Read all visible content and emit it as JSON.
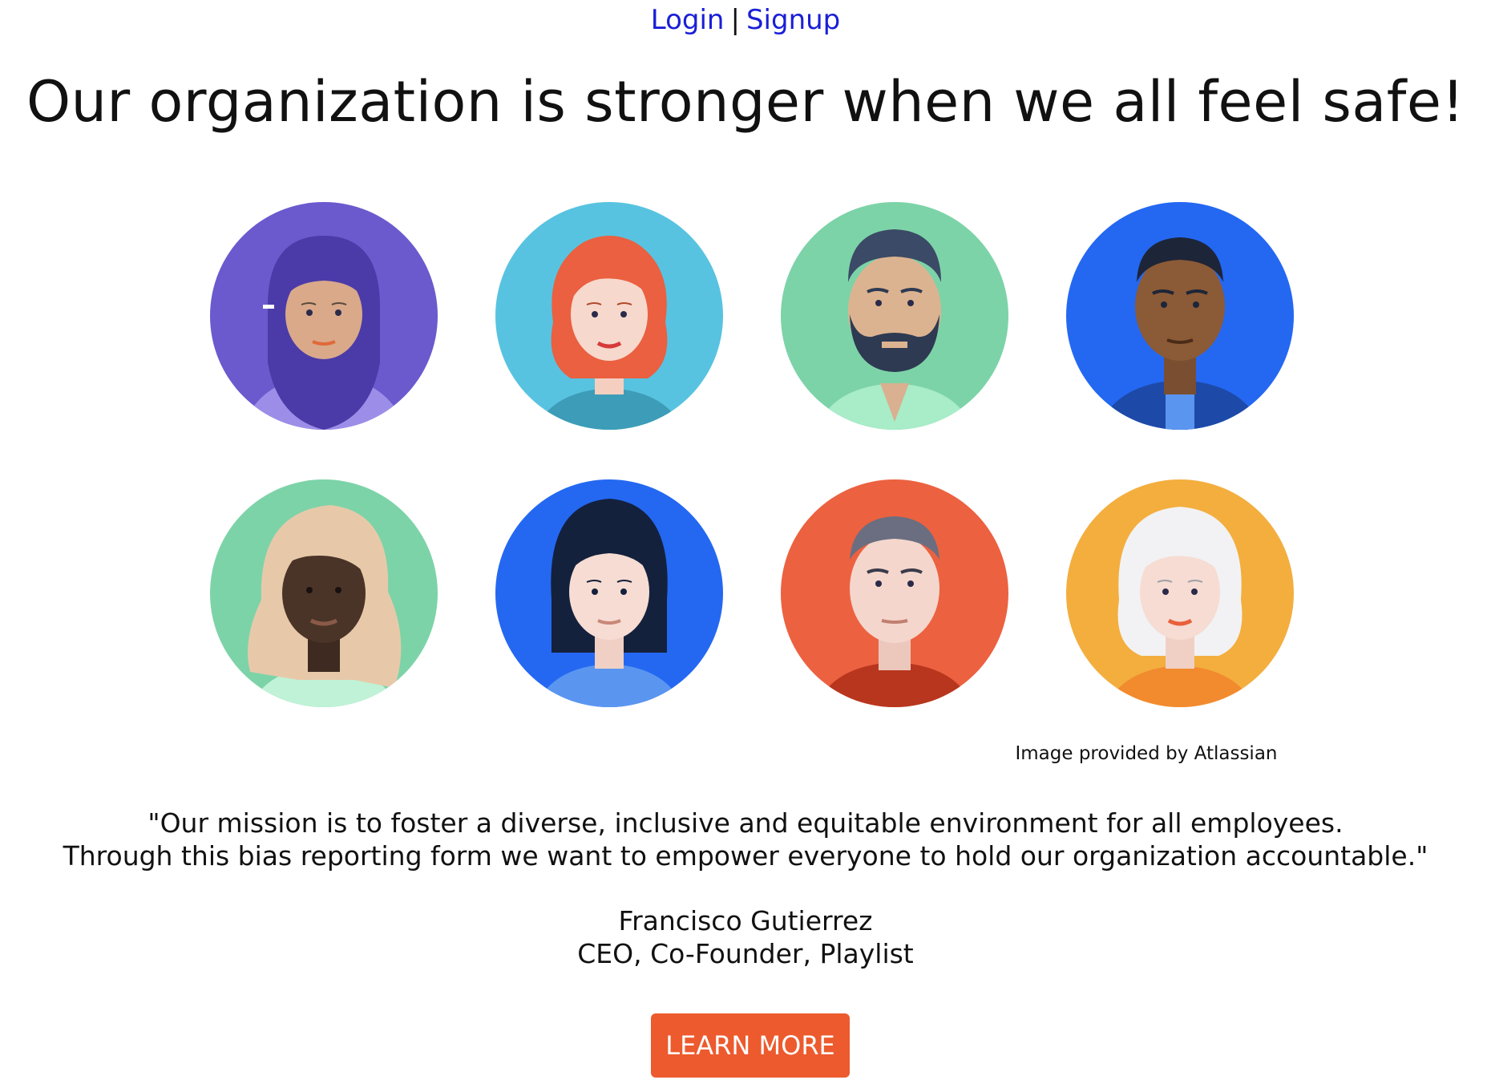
{
  "nav": {
    "login": "Login",
    "separator": "|",
    "signup": "Signup"
  },
  "hero": {
    "title": "Our organization is stronger when we all feel safe!"
  },
  "avatars": [
    {
      "icon": "woman-hijab-avatar-icon",
      "bg": "#6a5acd"
    },
    {
      "icon": "woman-red-hair-avatar-icon",
      "bg": "#58c3e0"
    },
    {
      "icon": "man-beard-avatar-icon",
      "bg": "#7dd3a8"
    },
    {
      "icon": "man-dark-skin-avatar-icon",
      "bg": "#2468f2"
    },
    {
      "icon": "woman-blonde-avatar-icon",
      "bg": "#7dd3a8"
    },
    {
      "icon": "woman-black-hair-avatar-icon",
      "bg": "#2468f2"
    },
    {
      "icon": "man-short-hair-avatar-icon",
      "bg": "#ec6140"
    },
    {
      "icon": "woman-white-hair-avatar-icon",
      "bg": "#f3ae3e"
    }
  ],
  "credit": "Image provided by Atlassian",
  "quote": {
    "line1": "\"Our mission is to foster a diverse, inclusive and equitable environment for all employees.",
    "line2": "Through this bias reporting form we want to empower everyone to hold our organization accountable.\""
  },
  "author": {
    "name": "Francisco Gutierrez",
    "role": "CEO, Co-Founder, Playlist"
  },
  "cta": {
    "label": "LEARN MORE",
    "color": "#ec5a2e"
  }
}
